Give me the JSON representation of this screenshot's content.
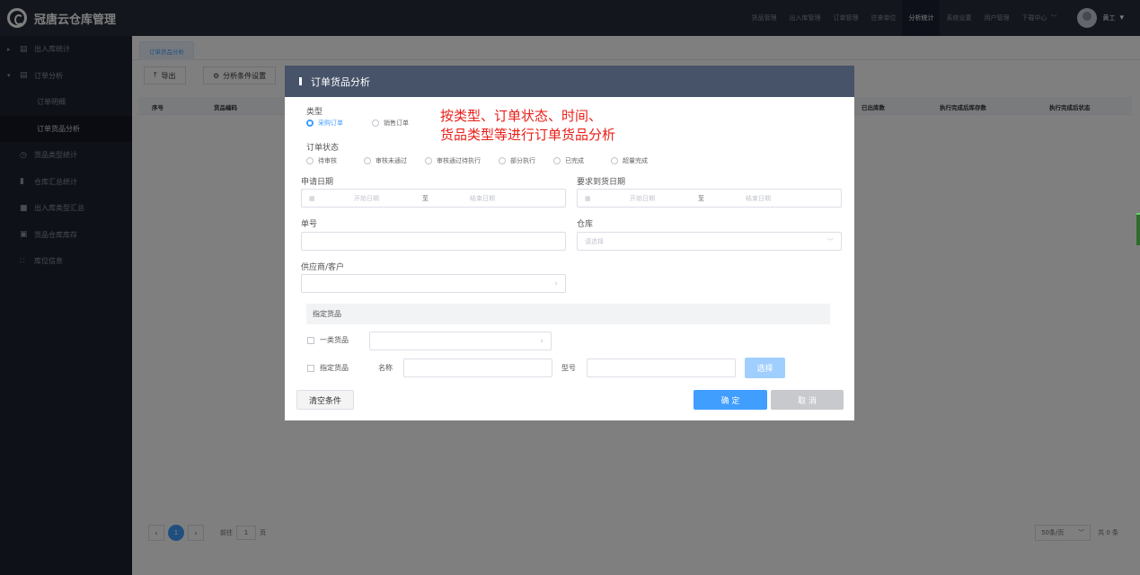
{
  "app": {
    "title": "冠唐云仓库管理"
  },
  "topnav": {
    "items": [
      "货品管理",
      "出入库管理",
      "订单管理",
      "往来单位",
      "分析统计",
      "系统设置",
      "用户管理",
      "下载中心"
    ],
    "active": "分析统计",
    "download_caret": "﹀",
    "user_name": "黄工",
    "user_caret": "▾"
  },
  "sidebar": {
    "items": [
      {
        "label": "出入库统计",
        "icon": "document-icon",
        "caret": "▸"
      },
      {
        "label": "订单分析",
        "icon": "document-icon",
        "caret": "▾"
      },
      {
        "label": "订单明细"
      },
      {
        "label": "订单货品分析"
      },
      {
        "label": "货品类型统计",
        "icon": "clock-icon"
      },
      {
        "label": "仓库汇总统计",
        "icon": "bar-chart-icon"
      },
      {
        "label": "出入库类型汇总",
        "icon": "list-icon"
      },
      {
        "label": "货品仓库库存",
        "icon": "box-icon"
      },
      {
        "label": "库位信息",
        "icon": "grid-icon"
      }
    ]
  },
  "content": {
    "tab": "订单货品分析",
    "toolbar": {
      "export": "导出",
      "analysis_settings": "分析条件设置"
    },
    "table_headers": [
      "序号",
      "货品编码",
      "已出库数",
      "执行完成后库存数",
      "执行完成后状态"
    ],
    "pagination": {
      "prev": "‹",
      "page": "1",
      "next": "›",
      "goto_prefix": "前往",
      "goto_value": "1",
      "goto_suffix": "页",
      "page_size": "50条/页",
      "page_size_caret": "﹀",
      "total": "共 0 条"
    }
  },
  "dialog": {
    "title": "订单货品分析",
    "annotation_line1": "按类型、订单状态、时间、",
    "annotation_line2": "货品类型等进行订单货品分析",
    "type": {
      "label": "类型",
      "options": [
        "采购订单",
        "销售订单"
      ],
      "selected": "采购订单"
    },
    "order_status": {
      "label": "订单状态",
      "options": [
        "待审核",
        "审核未通过",
        "审核通过待执行",
        "部分执行",
        "已完成",
        "超量完成"
      ]
    },
    "apply_date": {
      "label": "申请日期",
      "start_placeholder": "开始日期",
      "sep": "至",
      "end_placeholder": "结束日期"
    },
    "required_date": {
      "label": "要求到货日期",
      "start_placeholder": "开始日期",
      "sep": "至",
      "end_placeholder": "结束日期"
    },
    "order_no": {
      "label": "单号",
      "value": ""
    },
    "warehouse": {
      "label": "仓库",
      "placeholder": "请选择",
      "caret": "﹀"
    },
    "supplier": {
      "label": "供应商/客户",
      "caret": "›"
    },
    "goods_section": {
      "title": "指定货品",
      "category_label": "一类货品",
      "category_caret": "›",
      "specific_label": "指定货品",
      "name_label": "名称",
      "model_label": "型号",
      "select_button": "选择"
    },
    "buttons": {
      "clear": "清空条件",
      "confirm": "确 定",
      "cancel": "取 消"
    }
  },
  "colors": {
    "accent": "#409eff",
    "annotation": "#e8201a",
    "dialog_header": "#475369",
    "sidebar": "#1e2330"
  }
}
